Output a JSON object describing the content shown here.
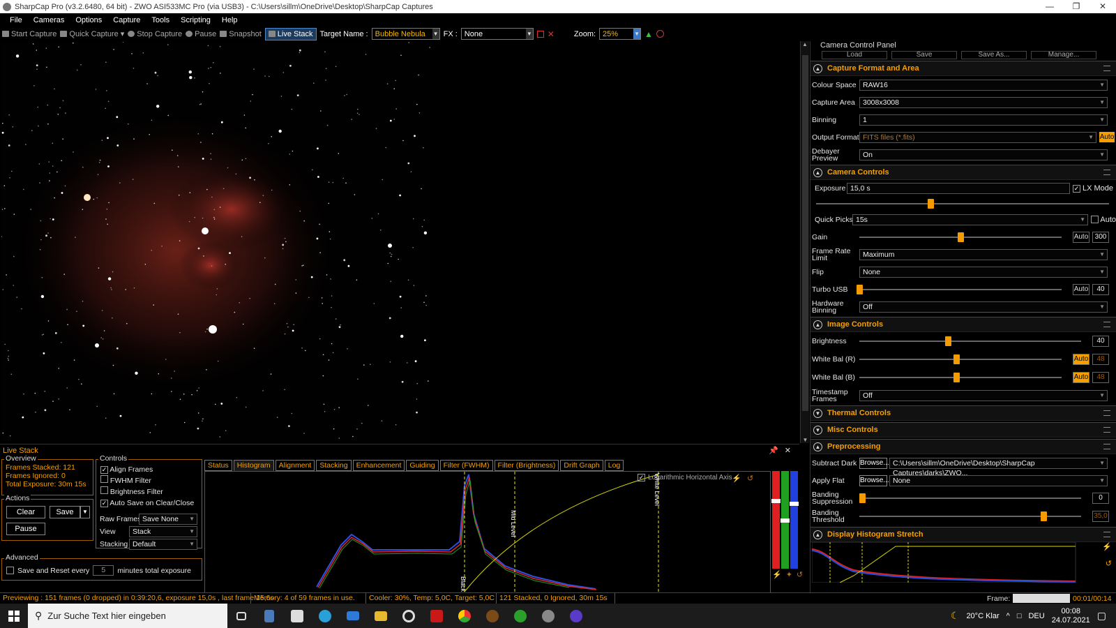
{
  "window": {
    "title": "SharpCap Pro (v3.2.6480, 64 bit) - ZWO ASI533MC Pro (via USB3) - C:\\Users\\sillm\\OneDrive\\Desktop\\SharpCap Captures"
  },
  "menu": [
    "File",
    "Cameras",
    "Options",
    "Capture",
    "Tools",
    "Scripting",
    "Help"
  ],
  "toolbar": {
    "start_capture": "Start Capture",
    "quick_capture": "Quick Capture",
    "stop_capture": "Stop Capture",
    "pause": "Pause",
    "snapshot": "Snapshot",
    "live_stack": "Live Stack",
    "target_label": "Target Name :",
    "target_value": "Bubble Nebula",
    "fx_label": "FX :",
    "fx_value": "None",
    "zoom_label": "Zoom:",
    "zoom_value": "25%"
  },
  "ccp": {
    "title": "Camera Control Panel",
    "profile_buttons": [
      "Load",
      "Save",
      "Save As...",
      "Manage..."
    ],
    "capture_format": {
      "title": "Capture Format and Area",
      "colour_space_label": "Colour Space",
      "colour_space": "RAW16",
      "capture_area_label": "Capture Area",
      "capture_area": "3008x3008",
      "binning_label": "Binning",
      "binning": "1",
      "output_format_label": "Output Format",
      "output_format": "FITS files (*.fits)",
      "auto": "Auto",
      "debayer_label": "Debayer Preview",
      "debayer": "On"
    },
    "camera_controls": {
      "title": "Camera Controls",
      "exposure_label": "Exposure",
      "exposure": "15,0 s",
      "lx_mode": "LX Mode",
      "quick_picks_label": "Quick Picks",
      "quick_picks": "15s",
      "quick_auto": "Auto",
      "gain_label": "Gain",
      "gain_auto": "Auto",
      "gain": "300",
      "gain_level": 0.5,
      "frame_rate_label": "Frame Rate Limit",
      "frame_rate": "Maximum",
      "flip_label": "Flip",
      "flip": "None",
      "turbo_label": "Turbo USB",
      "turbo_auto": "Auto",
      "turbo": "40",
      "turbo_level": 0.0,
      "hw_binning_label": "Hardware Binning",
      "hw_binning": "Off"
    },
    "image_controls": {
      "title": "Image Controls",
      "brightness_label": "Brightness",
      "brightness": "40",
      "brightness_level": 0.4,
      "wb_r_label": "White Bal (R)",
      "wb_r_auto": "Auto",
      "wb_r": "48",
      "wb_r_level": 0.48,
      "wb_b_label": "White Bal (B)",
      "wb_b_auto": "Auto",
      "wb_b": "48",
      "wb_b_level": 0.48,
      "timestamp_label": "Timestamp Frames",
      "timestamp": "Off"
    },
    "thermal": "Thermal Controls",
    "misc": "Misc Controls",
    "preprocessing": {
      "title": "Preprocessing",
      "subtract_dark_label": "Subtract Dark",
      "browse": "Browse...",
      "subtract_dark": "C:\\Users\\sillm\\OneDrive\\Desktop\\SharpCap Captures\\darks\\ZWO...",
      "apply_flat_label": "Apply Flat",
      "apply_flat": "None",
      "banding_supp_label": "Banding Suppression",
      "banding_supp": "0",
      "banding_thr_label": "Banding Threshold",
      "banding_thr": "35,0"
    },
    "display_stretch": "Display Histogram Stretch"
  },
  "live_stack": {
    "title": "Live Stack",
    "overview": {
      "title": "Overview",
      "frames_stacked": "Frames Stacked: 121",
      "frames_ignored": "Frames Ignored:  0",
      "total_exposure": "Total Exposure:  30m 15s"
    },
    "actions": {
      "title": "Actions",
      "clear": "Clear",
      "save": "Save",
      "pause": "Pause"
    },
    "controls": {
      "title": "Controls",
      "align": "Align Frames",
      "fwhm": "FWHM Filter",
      "brightness_filter": "Brightness Filter",
      "auto_save": "Auto Save on Clear/Close",
      "raw_frames_label": "Raw Frames",
      "raw_frames": "Save None",
      "view_label": "View",
      "view": "Stack",
      "stacking_label": "Stacking",
      "stacking": "Default"
    },
    "advanced": {
      "title": "Advanced",
      "save_reset": "Save and Reset every",
      "minutes_value": "5",
      "minutes_label": "minutes total exposure"
    },
    "tabs": [
      "Status",
      "Histogram",
      "Alignment",
      "Stacking",
      "Enhancement",
      "Guiding",
      "Filter (FWHM)",
      "Filter (Brightness)",
      "Drift Graph",
      "Log"
    ],
    "histogram": {
      "log_axis": "Logarithmic Horizontal Axis",
      "black_level": "Black Level",
      "mid_level": "Mid Level",
      "white_level": "White Level"
    }
  },
  "status": {
    "preview": "Previewing : 151 frames (0 dropped) in 0:39:20,6, exposure 15,0s , last frame 15,6s",
    "memory": "Memory: 4 of 59 frames in use.",
    "cooler": "Cooler: 30%, Temp: 5,0C, Target: 5,0C",
    "stacked": "121 Stacked, 0 Ignored, 30m 15s",
    "frame_label": "Frame:",
    "frame_time": "00:01/00:14"
  },
  "taskbar": {
    "search_placeholder": "Zur Suche Text hier eingeben",
    "weather": "20°C  Klar",
    "lang": "DEU",
    "time": "00:08",
    "date": "24.07.2021"
  }
}
